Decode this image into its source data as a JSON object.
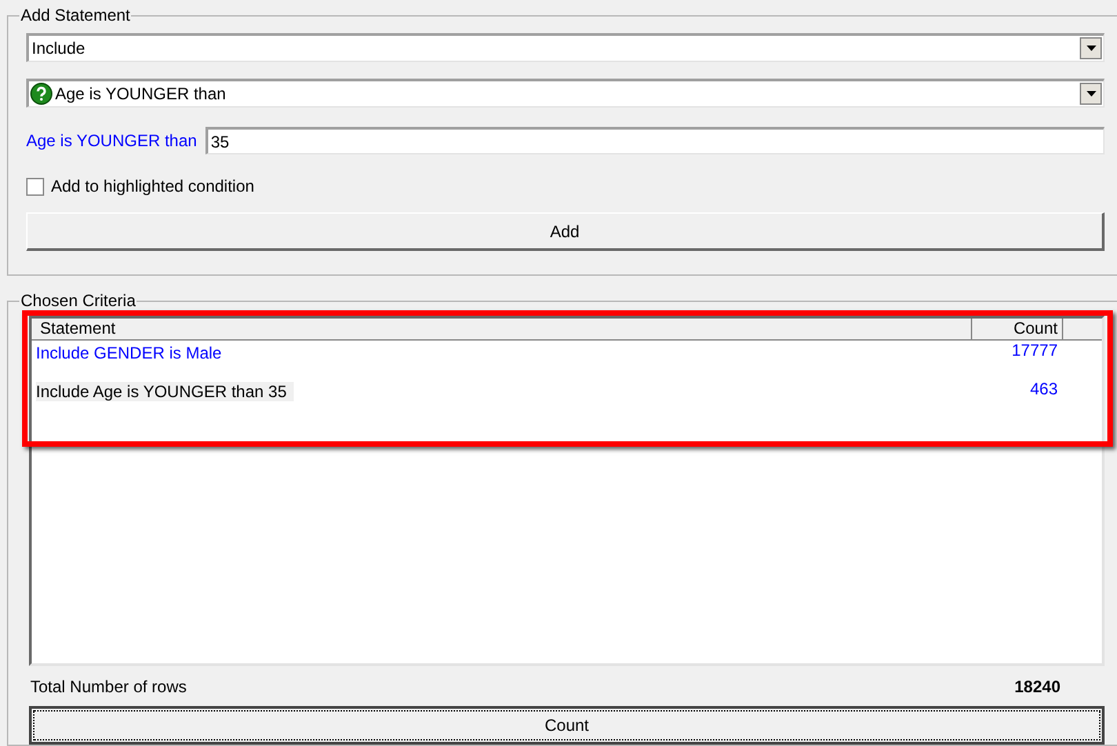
{
  "add_statement": {
    "title": "Add Statement",
    "mode_dropdown": {
      "value": "Include"
    },
    "condition_dropdown": {
      "value": "Age is YOUNGER than"
    },
    "value_field": {
      "label": "Age is YOUNGER than",
      "value": "35"
    },
    "add_to_highlighted": {
      "label": "Add to highlighted condition",
      "checked": false
    },
    "add_button": "Add"
  },
  "chosen_criteria": {
    "title": "Chosen Criteria",
    "columns": [
      "Statement",
      "Count"
    ],
    "rows": [
      {
        "statement": "Include GENDER is Male",
        "count": "17777",
        "selected": false
      },
      {
        "statement": "Include Age is YOUNGER than 35",
        "count": "463",
        "selected": true
      }
    ],
    "total_label": "Total Number of rows",
    "total_value": "18240",
    "count_button": "Count"
  }
}
